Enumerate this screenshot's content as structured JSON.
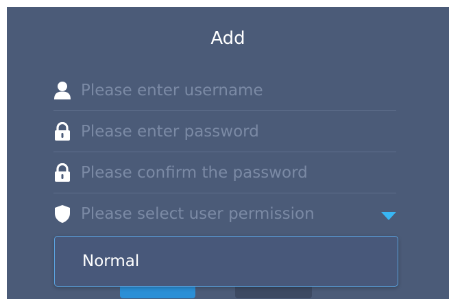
{
  "dialog": {
    "title": "Add"
  },
  "form": {
    "username": {
      "placeholder": "Please enter username",
      "value": "",
      "icon": "user-icon"
    },
    "password": {
      "placeholder": "Please enter password",
      "value": "",
      "icon": "lock-icon"
    },
    "confirm_password": {
      "placeholder": "Please confirm the password",
      "value": "",
      "icon": "lock-icon"
    },
    "permission": {
      "placeholder": "Please select user permission",
      "icon": "shield-icon",
      "caret_icon": "caret-down-icon",
      "caret_color": "#38b6f4",
      "options": [
        "Normal"
      ]
    }
  },
  "colors": {
    "background": "#4b5b78",
    "placeholder": "#7b8aa5",
    "accent": "#38b6f4",
    "primary_button": "#2b8fd6"
  }
}
